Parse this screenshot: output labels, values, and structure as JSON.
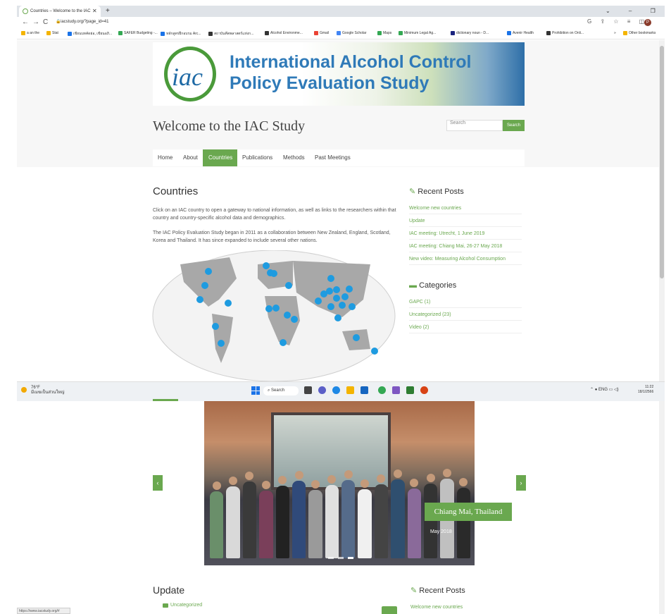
{
  "browser": {
    "tab_title": "Countries – Welcome to the IAC",
    "tab_close": "✕",
    "new_tab": "+",
    "window_controls": "⌄ – ❐ ✕",
    "back": "←",
    "forward": "→",
    "reload": "C",
    "url": "iacstudy.org/?page_id=41",
    "right_icons": "G ⇪ ☆ ≡ ◫",
    "profile_initial": "P",
    "bookmarks": [
      {
        "label": "a an the",
        "color": "#f4b400"
      },
      {
        "label": "Stat",
        "color": "#f4b400"
      },
      {
        "label": "เขียนบทคัดย่อ, เขียนอภิ...",
        "color": "#1a73e8"
      },
      {
        "label": "SAFER Budgeting -...",
        "color": "#34a853"
      },
      {
        "label": "หลักสูตรฝึกอบรม Arc...",
        "color": "#1a73e8"
      },
      {
        "label": "สถาบันคีตพลาสตร์แห่งก...",
        "color": "#333333"
      },
      {
        "label": "Alcohol Environme...",
        "color": "#333333"
      },
      {
        "label": "Gmail",
        "color": "#ea4335"
      },
      {
        "label": "Google Scholar",
        "color": "#4285f4"
      },
      {
        "label": "Maps",
        "color": "#34a853"
      },
      {
        "label": "Minimum Legal Ag...",
        "color": "#34a853"
      },
      {
        "label": "dictionary noun - D...",
        "color": "#1a237e"
      },
      {
        "label": "Avenir Health",
        "color": "#1a73e8"
      },
      {
        "label": "Prohibition on Onli...",
        "color": "#333333"
      }
    ],
    "bookmarks_more": "»",
    "other_bookmarks": "Other bookmarks"
  },
  "site": {
    "banner_logo_text": "iac",
    "banner_line1": "International Alcohol Control",
    "banner_line2": "Policy Evaluation Study",
    "title": "Welcome to the IAC Study",
    "search_placeholder": "Search",
    "search_button": "Search",
    "nav": [
      "Home",
      "About",
      "Countries",
      "Publications",
      "Methods",
      "Past Meetings"
    ]
  },
  "main": {
    "heading": "Countries",
    "para1": "Click on an IAC country to open a gateway to national information, as well as links to the researchers within that country and country-specific alcohol data and demographics.",
    "para2": "The IAC Policy Evaluation Study began in 2011 as a collaboration between New Zealand, England, Scotland, Korea and Thailand. It has since expanded to include several other nations."
  },
  "sidebar": {
    "recent_heading": "Recent Posts",
    "recent": [
      "Welcome new countries",
      "Update",
      "IAC meeting: Utrecht, 1 June 2019",
      "IAC meeting: Chiang Mai, 26-27 May 2018",
      "New video: Measuring Alcohol Consumption"
    ],
    "categories_heading": "Categories",
    "categories": [
      "GAPC (1)",
      "Uncategorized (23)",
      "Video (2)"
    ]
  },
  "taskbar": {
    "temp": "76°F",
    "weather_desc": "มีเมฆเป็นส่วนใหญ่",
    "search": "Search",
    "tray": "ENG",
    "time": "11:22",
    "date": "18/1/2566"
  },
  "lower": {
    "carousel_prev": "‹",
    "carousel_next": "›",
    "caption_title": "Chiang Mai, Thailand",
    "caption_date": "May 2018",
    "update_heading": "Update",
    "update_category": "Uncategorized",
    "recent_heading": "Recent Posts",
    "recent_first": "Welcome new countries",
    "status_url": "https://www.iacstudy.org/#"
  },
  "colors": {
    "accent": "#6aa84f",
    "brand_blue": "#2f7ab8",
    "map_dot": "#1e9be0"
  }
}
